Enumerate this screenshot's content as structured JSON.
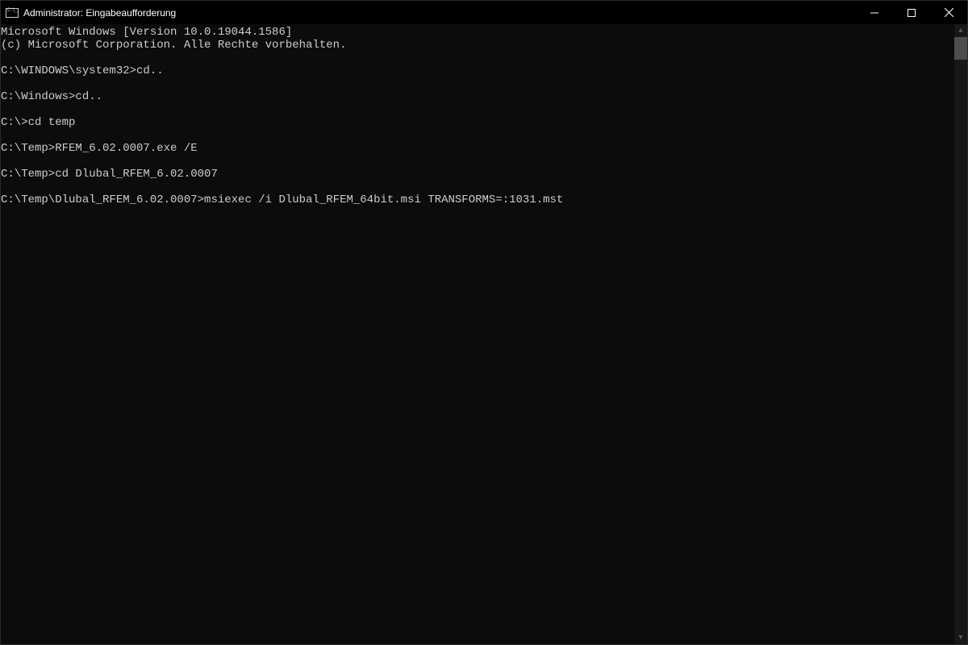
{
  "titlebar": {
    "title": "Administrator: Eingabeaufforderung"
  },
  "terminal": {
    "lines": [
      "Microsoft Windows [Version 10.0.19044.1586]",
      "(c) Microsoft Corporation. Alle Rechte vorbehalten.",
      "",
      "C:\\WINDOWS\\system32>cd..",
      "",
      "C:\\Windows>cd..",
      "",
      "C:\\>cd temp",
      "",
      "C:\\Temp>RFEM_6.02.0007.exe /E",
      "",
      "C:\\Temp>cd Dlubal_RFEM_6.02.0007",
      "",
      "C:\\Temp\\Dlubal_RFEM_6.02.0007>msiexec /i Dlubal_RFEM_64bit.msi TRANSFORMS=:1031.mst"
    ]
  }
}
